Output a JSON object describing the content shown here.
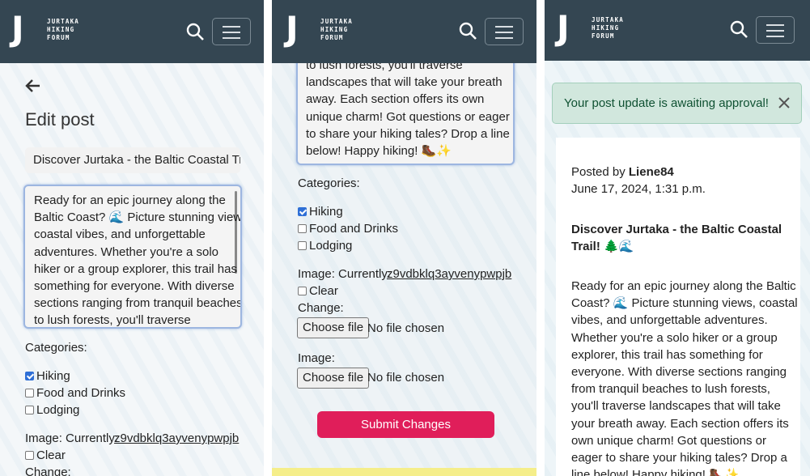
{
  "brand": {
    "initial": "J",
    "line1": "JURTAKA",
    "line2": "HIKING",
    "line3": "FORUM"
  },
  "edit": {
    "heading": "Edit post",
    "title_value": "Discover Jurtaka - the Baltic Coastal Trail! 🌲🌊",
    "body_lines_top": [
      "Ready for an epic journey along the",
      "Baltic Coast? 🌊 Picture stunning views,",
      "coastal vibes, and unforgettable",
      "adventures. Whether you're a solo",
      "hiker or a group explorer, this trail has",
      "something for everyone. With diverse",
      "sections ranging from tranquil beaches",
      "to lush forests, you'll traverse"
    ],
    "body_lines_bottom": [
      "to lush forests, you'll traverse",
      "landscapes that will take your breath",
      "away. Each section offers its own",
      "unique charm! Got questions or eager",
      "to share your hiking tales? Drop a line",
      "below! Happy hiking! 🥾✨"
    ],
    "categories_label": "Categories:",
    "categories": [
      {
        "label": "Hiking",
        "checked": true
      },
      {
        "label": "Food and Drinks",
        "checked": false
      },
      {
        "label": "Lodging",
        "checked": false
      }
    ],
    "image_currently_label": "Image: Currently:",
    "image_filename": "z9vdbklq3ayvenypwpjb",
    "clear_label": "Clear",
    "change_label": "Change:",
    "choose_file_label": "Choose file",
    "no_file_label": "No file chosen",
    "image_label": "Image:",
    "submit_label": "Submit Changes"
  },
  "post": {
    "alert": "Your post update is awaiting approval!",
    "posted_by_prefix": "Posted by",
    "author": "Liene84",
    "date": "June 17, 2024, 1:31 p.m.",
    "title_line1": "Discover Jurtaka - the Baltic Coastal",
    "title_line2": "Trail! 🌲🌊",
    "body_lines": [
      "Ready for an epic journey along the Baltic",
      "Coast? 🌊 Picture stunning views, coastal",
      "vibes, and unforgettable adventures.",
      "Whether you're a solo hiker or a group",
      "explorer, this trail has something for",
      "everyone. With diverse sections ranging",
      "from tranquil beaches to lush forests,",
      "you'll traverse landscapes that will take",
      "your breath away. Each section offers its",
      "own unique charm! Got questions or",
      "eager to share your hiking tales? Drop a",
      "line below! Happy hiking! 🥾✨"
    ]
  },
  "colors": {
    "nav": "#344652",
    "submit": "#e01e5a",
    "checkbox": "#2f6fd6",
    "alert_bg": "#d1e7dd",
    "alert_text": "#0f5132"
  },
  "icons": {
    "search": "search-icon",
    "menu": "hamburger-menu-icon",
    "back": "arrow-left-icon",
    "close": "close-icon"
  }
}
